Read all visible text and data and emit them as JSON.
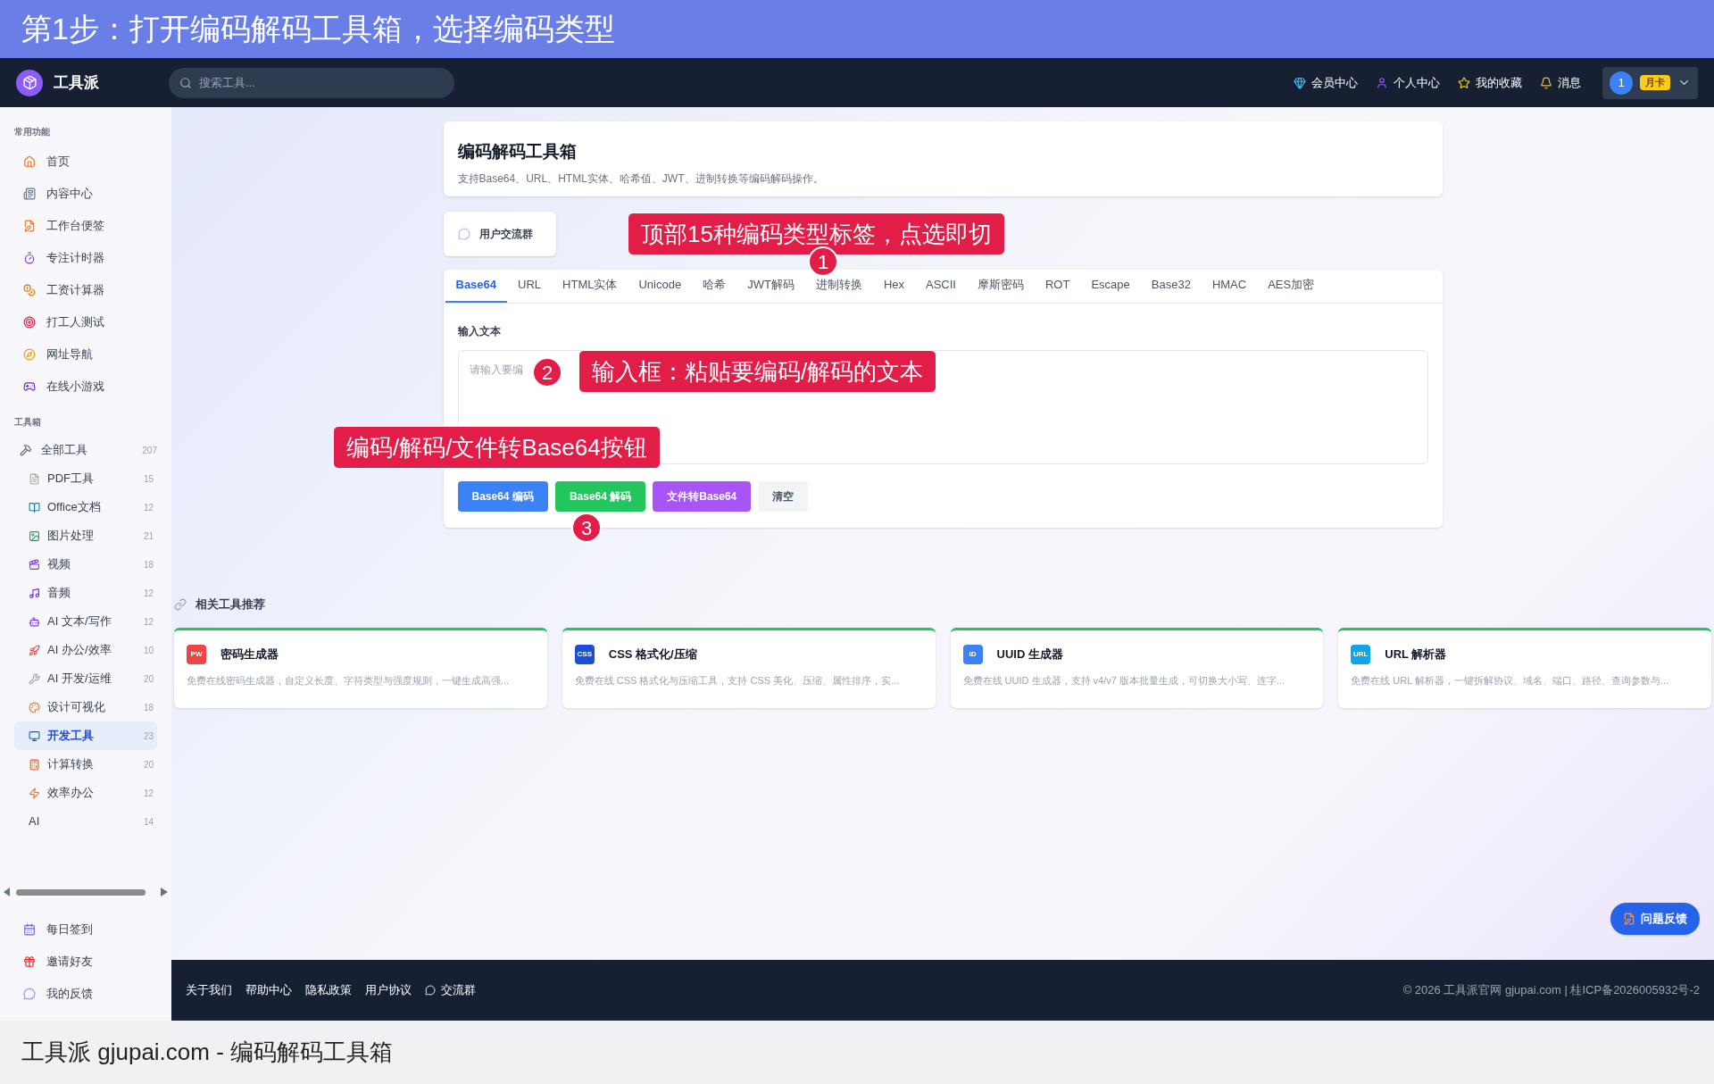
{
  "banner": {
    "text": "第1步：打开编码解码工具箱，选择编码类型"
  },
  "topbar": {
    "brand": "工具派",
    "search": {
      "placeholder": "搜索工具..."
    },
    "links": [
      "会员中心",
      "个人中心",
      "我的收藏",
      "消息"
    ],
    "user": {
      "avatar": "1",
      "badge": "月卡"
    }
  },
  "sidebar": {
    "common_title": "常用功能",
    "common_items": [
      "首页",
      "内容中心",
      "工作台便签",
      "专注计时器",
      "工资计算器",
      "打工人测试",
      "网址导航",
      "在线小游戏"
    ],
    "toolbox_title": "工具箱",
    "all_tools": {
      "label": "全部工具",
      "count": "207"
    },
    "categories": [
      {
        "label": "PDF工具",
        "count": "15",
        "selected": false
      },
      {
        "label": "Office文档",
        "count": "12",
        "selected": false
      },
      {
        "label": "图片处理",
        "count": "21",
        "selected": false
      },
      {
        "label": "视频",
        "count": "18",
        "selected": false
      },
      {
        "label": "音频",
        "count": "12",
        "selected": false
      },
      {
        "label": "AI 文本/写作",
        "count": "12",
        "selected": false
      },
      {
        "label": "AI 办公/效率",
        "count": "10",
        "selected": false
      },
      {
        "label": "AI 开发/运维",
        "count": "20",
        "selected": false
      },
      {
        "label": "设计可视化",
        "count": "18",
        "selected": false
      },
      {
        "label": "开发工具",
        "count": "23",
        "selected": true
      },
      {
        "label": "计算转换",
        "count": "20",
        "selected": false
      },
      {
        "label": "效率办公",
        "count": "12",
        "selected": false
      },
      {
        "label": "AI",
        "count": "14",
        "selected": false
      }
    ],
    "bottom_items": [
      "每日签到",
      "邀请好友",
      "我的反馈"
    ]
  },
  "header": {
    "title": "编码解码工具箱",
    "subtitle": "支持Base64、URL、HTML实体、哈希值、JWT、进制转换等编码解码操作。"
  },
  "community_button": "用户交流群",
  "tabs": [
    {
      "label": "Base64",
      "selected": true
    },
    {
      "label": "URL",
      "selected": false
    },
    {
      "label": "HTML实体",
      "selected": false
    },
    {
      "label": "Unicode",
      "selected": false
    },
    {
      "label": "哈希",
      "selected": false
    },
    {
      "label": "JWT解码",
      "selected": false
    },
    {
      "label": "进制转换",
      "selected": false
    },
    {
      "label": "Hex",
      "selected": false
    },
    {
      "label": "ASCII",
      "selected": false
    },
    {
      "label": "摩斯密码",
      "selected": false
    },
    {
      "label": "ROT",
      "selected": false
    },
    {
      "label": "Escape",
      "selected": false
    },
    {
      "label": "Base32",
      "selected": false
    },
    {
      "label": "HMAC",
      "selected": false
    },
    {
      "label": "AES加密",
      "selected": false
    }
  ],
  "input": {
    "label": "输入文本",
    "placeholder": "请输入要编"
  },
  "buttons": [
    {
      "label": "Base64 编码",
      "kind": "encode"
    },
    {
      "label": "Base64 解码",
      "kind": "decode"
    },
    {
      "label": "文件转Base64",
      "kind": "file"
    },
    {
      "label": "清空",
      "kind": "clear"
    }
  ],
  "related": {
    "title": "相关工具推荐",
    "cards": [
      {
        "badge": "PW",
        "color": "#ef4444",
        "title": "密码生成器",
        "desc": "免费在线密码生成器，自定义长度、字符类型与强度规则，一键生成高强..."
      },
      {
        "badge": "CSS",
        "color": "#1d4ed8",
        "title": "CSS 格式化/压缩",
        "desc": "免费在线 CSS 格式化与压缩工具，支持 CSS 美化、压缩、属性排序，实..."
      },
      {
        "badge": "ID",
        "color": "#3b82f6",
        "title": "UUID 生成器",
        "desc": "免费在线 UUID 生成器，支持 v4/v7 版本批量生成，可切换大小写、连字..."
      },
      {
        "badge": "URL",
        "color": "#0ea5e9",
        "title": "URL 解析器",
        "desc": "免费在线 URL 解析器，一键拆解协议、域名、端口、路径、查询参数与..."
      }
    ]
  },
  "feedback_button": "问题反馈",
  "footer": {
    "links": [
      "关于我们",
      "帮助中心",
      "隐私政策",
      "用户协议"
    ],
    "community": "交流群",
    "copyright": "© 2026 工具派官网 gjupai.com | 桂ICP备2026005932号-2"
  },
  "annotations": [
    {
      "number": "1",
      "text": "顶部15种编码类型标签，点选即切"
    },
    {
      "number": "2",
      "text": "输入框：粘贴要编码/解码的文本"
    },
    {
      "number": "3",
      "text": "编码/解码/文件转Base64按钮"
    }
  ],
  "caption": "工具派 gjupai.com - 编码解码工具箱"
}
